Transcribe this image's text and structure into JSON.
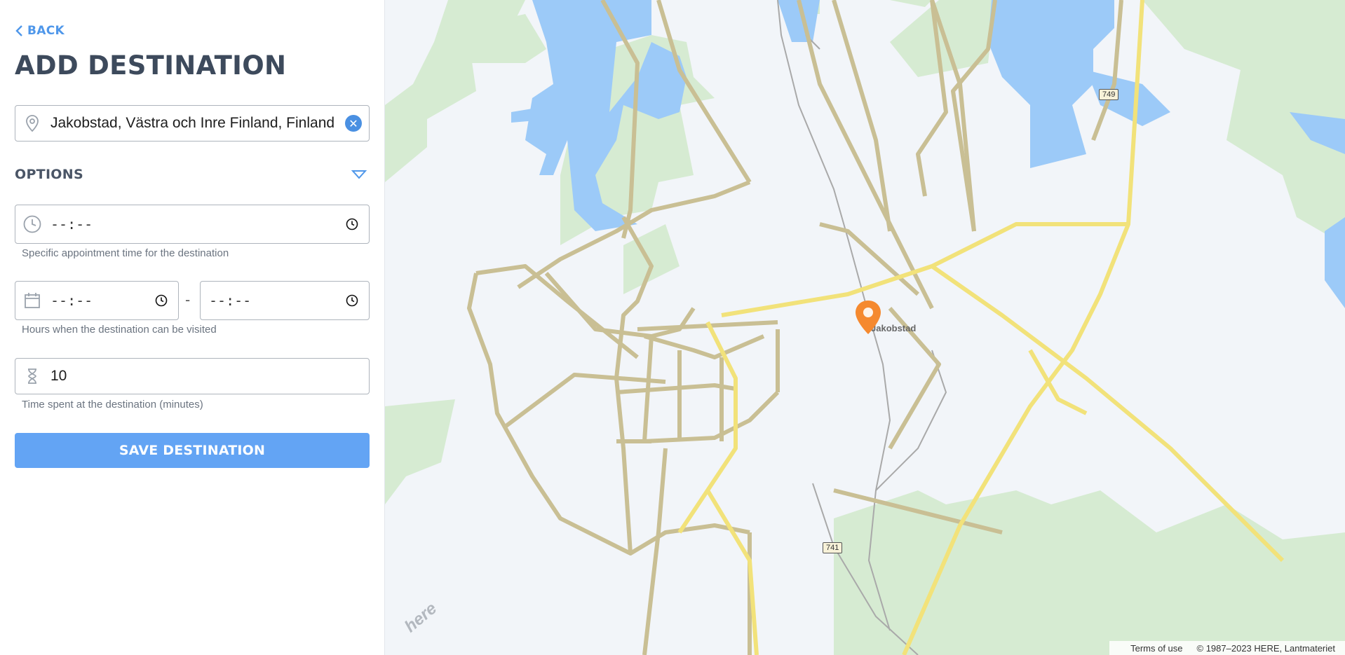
{
  "sidebar": {
    "back_label": "BACK",
    "title": "ADD DESTINATION",
    "address": {
      "value": "Jakobstad, Västra och Inre Finland, Finland"
    },
    "options_label": "OPTIONS",
    "appointment": {
      "value": "--:--",
      "hint": "Specific appointment time for the destination"
    },
    "hours": {
      "from": "--:--",
      "separator": "-",
      "to": "--:--",
      "hint": "Hours when the destination can be visited"
    },
    "duration": {
      "value": "10",
      "hint": "Time spent at the destination (minutes)"
    },
    "save_label": "SAVE DESTINATION"
  },
  "map": {
    "city_label": "Jakobstad",
    "road_shields": [
      "749",
      "741"
    ],
    "logo_text": "here",
    "attribution": {
      "terms": "Terms of use",
      "copyright": "© 1987–2023 HERE, Lantmateriet"
    }
  },
  "colors": {
    "accent": "#4f97ea",
    "button": "#63a4f4",
    "pin": "#f5892f",
    "water": "#9ccaf8",
    "forest": "#d6ebd2"
  }
}
